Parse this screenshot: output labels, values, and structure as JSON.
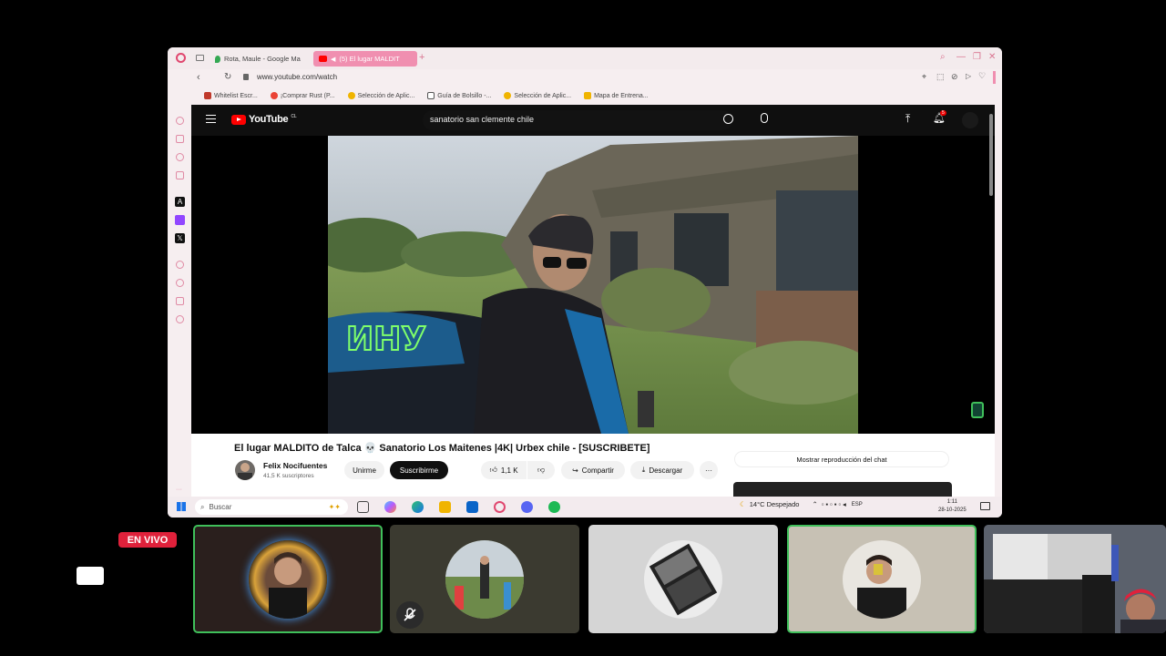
{
  "browser": {
    "tabs": [
      {
        "label": "Rota, Maule - Google Ma",
        "active": false
      },
      {
        "label": "(5) El lugar MALDIT",
        "active": true
      }
    ],
    "url": "www.youtube.com/watch",
    "bookmarks": [
      "Whitelist Escr...",
      "¡Comprar Rust (P...",
      "Selección de Aplic...",
      "Guía de Bolsillo -...",
      "Selección de Aplic...",
      "Mapa de Entrena..."
    ]
  },
  "youtube": {
    "logo": "YouTube",
    "logo_country": "CL",
    "search_query": "sanatorio san clemente chile",
    "notification_count": "5",
    "video_title": "El lugar MALDITO de Talca 💀 Sanatorio Los Maitenes |4K| Urbex chile - [SUSCRIBETE]",
    "channel_name": "Felix Nocifuentes",
    "subscribers": "41,5 K suscriptores",
    "join_label": "Unirme",
    "subscribe_label": "Suscribirme",
    "likes": "1,1 K",
    "share_label": "Compartir",
    "download_label": "Descargar",
    "chat_replay_label": "Mostrar reproducción del chat"
  },
  "taskbar": {
    "search_placeholder": "Buscar",
    "weather": "14°C Despejado",
    "language": "ESP",
    "time": "1:11",
    "date": "28-10-2025"
  },
  "call": {
    "live_label": "EN VIVO",
    "participants": [
      {
        "speaking": true,
        "muted": false
      },
      {
        "speaking": false,
        "muted": true
      },
      {
        "speaking": false,
        "muted": false
      },
      {
        "speaking": true,
        "muted": false
      },
      {
        "speaking": false,
        "muted": false
      }
    ]
  },
  "colors": {
    "accent": "#f08fb0",
    "yt_red": "#ff0000",
    "live_red": "#e0213b",
    "speaking_green": "#3fbf5a"
  }
}
